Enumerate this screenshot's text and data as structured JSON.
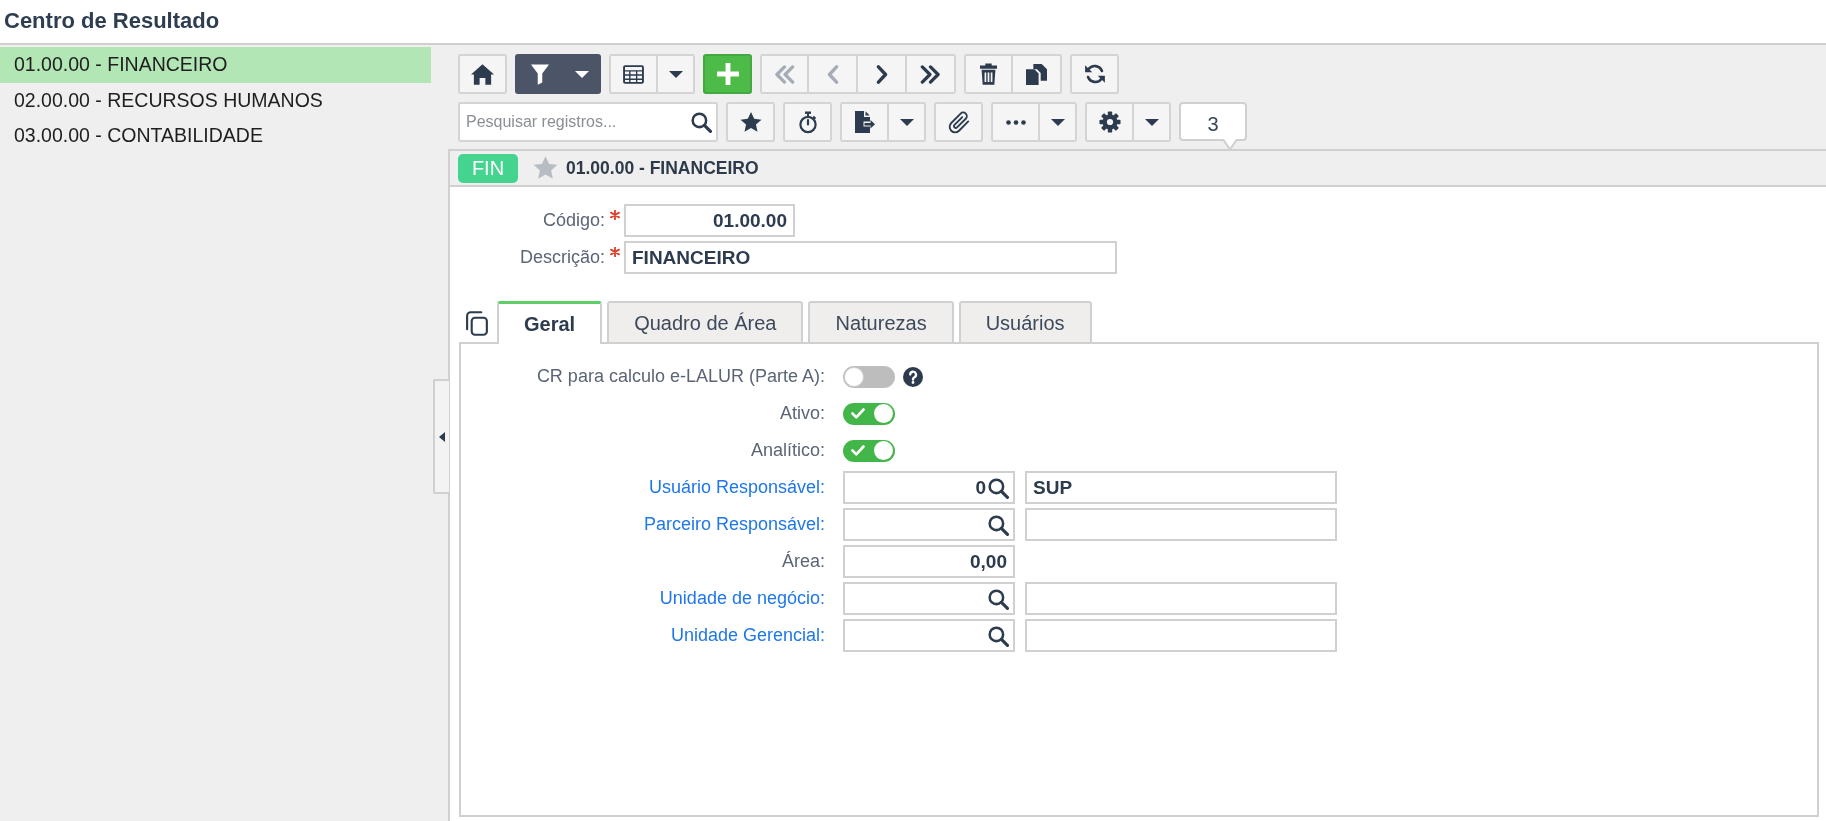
{
  "window": {
    "title": "Centro de Resultado"
  },
  "sidebar": {
    "items": [
      {
        "label": "01.00.00 - FINANCEIRO",
        "selected": true
      },
      {
        "label": "02.00.00 - RECURSOS HUMANOS",
        "selected": false
      },
      {
        "label": "03.00.00 - CONTABILIDADE",
        "selected": false
      }
    ]
  },
  "toolbar": {
    "filter_active": true,
    "navigation": [
      {
        "disabled": true
      },
      {
        "disabled": true
      },
      {
        "disabled": false
      },
      {
        "disabled": false
      }
    ],
    "search": {
      "placeholder": "Pesquisar registros..."
    },
    "record_count": "3"
  },
  "record": {
    "badge": "FIN",
    "favorite": false,
    "title": "01.00.00 - FINANCEIRO"
  },
  "fields": [
    {
      "kind": "code",
      "label": "Código:",
      "required": true,
      "value": "01.00.00"
    },
    {
      "kind": "text",
      "label": "Descrição:",
      "required": true,
      "value": "FINANCEIRO"
    }
  ],
  "tabs": [
    {
      "label": "Geral",
      "selected": true
    },
    {
      "label": "Quadro de Área",
      "selected": false
    },
    {
      "label": "Naturezas",
      "selected": false
    },
    {
      "label": "Usuários",
      "selected": false
    }
  ],
  "general": {
    "toggles": [
      {
        "label": "CR para calculo e-LALUR (Parte A):",
        "on": false,
        "help": true
      },
      {
        "label": "Ativo:",
        "on": true,
        "help": false
      },
      {
        "label": "Analítico:",
        "on": true,
        "help": false
      }
    ],
    "rows": [
      {
        "kind": "lookup",
        "label": "Usuário Responsável:",
        "code": "0",
        "name": "SUP"
      },
      {
        "kind": "lookup",
        "label": "Parceiro Responsável:"
      },
      {
        "kind": "number",
        "label": "Área:",
        "value": "0,00"
      },
      {
        "kind": "lookup",
        "label": "Unidade de negócio:"
      },
      {
        "kind": "lookup",
        "label": "Unidade Gerencial:"
      }
    ]
  }
}
